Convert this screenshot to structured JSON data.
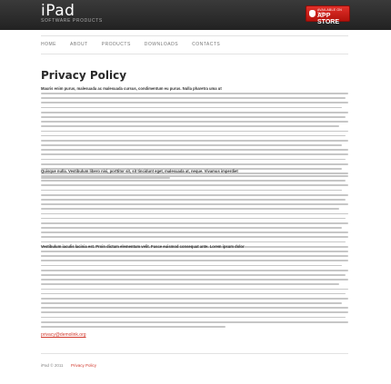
{
  "header": {
    "logo_title": "iPad",
    "logo_subtitle": "SOFTWARE PRODUCTS",
    "store_badge_small": "AVAILABLE ON THE",
    "store_badge_big": "APP STORE"
  },
  "nav": [
    "HOME",
    "ABOUT",
    "PRODUCTS",
    "DOWNLOADS",
    "CONTACTS"
  ],
  "main": {
    "title": "Privacy Policy",
    "sections": [
      {
        "lead": "Mauris enim purus, malesuada ac malesuada cursus, condimentum eu purus. Nulla pharetra uma ut"
      },
      {
        "lead": "Quisque nulla. Vestibulum libero nisi, porttitor sit, sit tincidunt eget, malesuada at, neque. Vivamus imperdiet"
      },
      {
        "lead": "Vestibulum iaculis lacinia est. Proin dictum elementum velit. Fusce euismod consequat ante. Lorem ipsum dolor"
      }
    ],
    "email": "privacy@demolink.org"
  },
  "footer": {
    "copyright": "iPad © 2011",
    "link": "Privacy Policy"
  },
  "colors": {
    "accent": "#d23a2e",
    "header_bg": "#2b2b2b",
    "badge": "#c81e17"
  }
}
